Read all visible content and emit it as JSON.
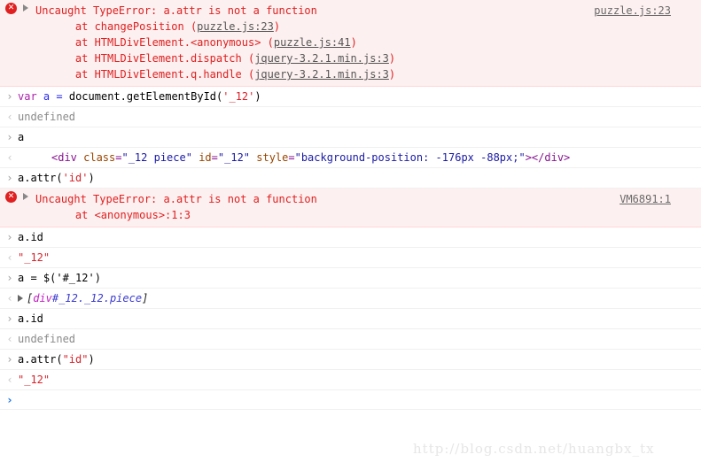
{
  "console": {
    "error_icon_glyph": "✕",
    "entries": [
      {
        "kind": "error",
        "title": "Uncaught TypeError: a.attr is not a function",
        "source_link": "puzzle.js:23",
        "stack": [
          {
            "pre": "    at changePosition (",
            "link": "puzzle.js:23",
            "post": ")"
          },
          {
            "pre": "    at HTMLDivElement.<anonymous> (",
            "link": "puzzle.js:41",
            "post": ")"
          },
          {
            "pre": "    at HTMLDivElement.dispatch (",
            "link": "jquery-3.2.1.min.js:3",
            "post": ")"
          },
          {
            "pre": "    at HTMLDivElement.q.handle (",
            "link": "jquery-3.2.1.min.js:3",
            "post": ")"
          }
        ]
      },
      {
        "kind": "input",
        "prompt": "›",
        "tokens": [
          {
            "t": "var",
            "c": "k-keyword"
          },
          {
            "t": " ",
            "c": "k-plain"
          },
          {
            "t": "a",
            "c": "k-var"
          },
          {
            "t": " ",
            "c": "k-plain"
          },
          {
            "t": "=",
            "c": "k-op"
          },
          {
            "t": " document.getElementById(",
            "c": "k-plain"
          },
          {
            "t": "'_12'",
            "c": "k-string"
          },
          {
            "t": ")",
            "c": "k-plain"
          }
        ]
      },
      {
        "kind": "output",
        "prompt": "‹",
        "tokens": [
          {
            "t": "undefined",
            "c": "k-undef"
          }
        ]
      },
      {
        "kind": "input",
        "prompt": "›",
        "tokens": [
          {
            "t": "a",
            "c": "k-plain"
          }
        ]
      },
      {
        "kind": "dom",
        "prompt": "‹",
        "parts": [
          {
            "t": "<div ",
            "c": "punct"
          },
          {
            "t": "class",
            "c": "attrname"
          },
          {
            "t": "=",
            "c": "punct"
          },
          {
            "t": "\"_12 piece\"",
            "c": "attrval"
          },
          {
            "t": " ",
            "c": "punct"
          },
          {
            "t": "id",
            "c": "attrname"
          },
          {
            "t": "=",
            "c": "punct"
          },
          {
            "t": "\"_12\"",
            "c": "attrval"
          },
          {
            "t": " ",
            "c": "punct"
          },
          {
            "t": "style",
            "c": "attrname"
          },
          {
            "t": "=",
            "c": "punct"
          },
          {
            "t": "\"background-position: -176px -88px;\"",
            "c": "attrval"
          },
          {
            "t": "></div>",
            "c": "punct"
          }
        ]
      },
      {
        "kind": "input",
        "prompt": "›",
        "tokens": [
          {
            "t": "a.attr(",
            "c": "k-plain"
          },
          {
            "t": "'id'",
            "c": "k-string"
          },
          {
            "t": ")",
            "c": "k-plain"
          }
        ]
      },
      {
        "kind": "error",
        "title": "Uncaught TypeError: a.attr is not a function",
        "source_link": "VM6891:1",
        "stack": [
          {
            "pre": "    at <anonymous>:1:3",
            "link": "",
            "post": ""
          }
        ]
      },
      {
        "kind": "input",
        "prompt": "›",
        "tokens": [
          {
            "t": "a.id",
            "c": "k-plain"
          }
        ]
      },
      {
        "kind": "output",
        "prompt": "‹",
        "tokens": [
          {
            "t": "\"_12\"",
            "c": "k-string"
          }
        ]
      },
      {
        "kind": "input",
        "prompt": "›",
        "tokens": [
          {
            "t": "a = $('#_12')",
            "c": "k-plain"
          }
        ]
      },
      {
        "kind": "jquery",
        "prompt": "‹",
        "parts": [
          {
            "t": "[",
            "c": "jq-plain"
          },
          {
            "t": "div",
            "c": "jq-tag"
          },
          {
            "t": "#_12._12.piece",
            "c": "jq-sel"
          },
          {
            "t": "]",
            "c": "jq-plain"
          }
        ]
      },
      {
        "kind": "input",
        "prompt": "›",
        "tokens": [
          {
            "t": "a.id",
            "c": "k-plain"
          }
        ]
      },
      {
        "kind": "output",
        "prompt": "‹",
        "tokens": [
          {
            "t": "undefined",
            "c": "k-undef"
          }
        ]
      },
      {
        "kind": "input",
        "prompt": "›",
        "tokens": [
          {
            "t": "a.attr(",
            "c": "k-plain"
          },
          {
            "t": "\"id\"",
            "c": "k-string"
          },
          {
            "t": ")",
            "c": "k-plain"
          }
        ]
      },
      {
        "kind": "output",
        "prompt": "‹",
        "tokens": [
          {
            "t": "\"_12\"",
            "c": "k-string"
          }
        ]
      },
      {
        "kind": "active-prompt",
        "prompt": "›",
        "tokens": []
      }
    ]
  },
  "watermark": {
    "text": "http://blog.csdn.net/huangbx_tx"
  }
}
